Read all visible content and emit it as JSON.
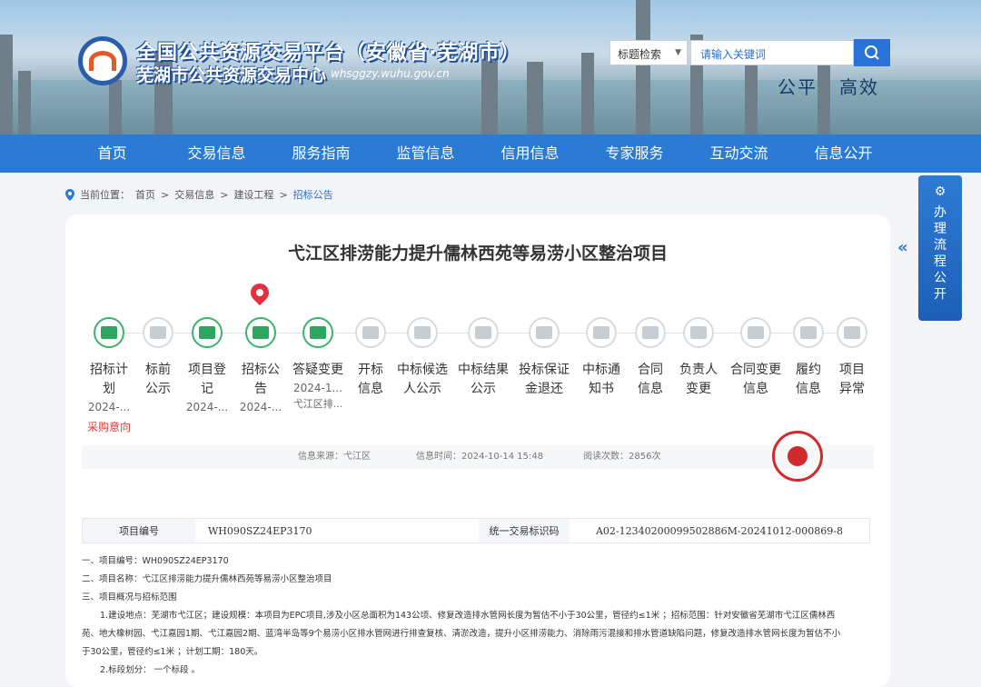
{
  "header": {
    "brand_line1": "全国公共资源交易平台（安徽省·芜湖市）",
    "brand_line2": "芜湖市公共资源交易中心",
    "domain": "whsggzy.wuhu.gov.cn",
    "search_select": "标题检索",
    "search_placeholder": "请输入关键词",
    "motto1": "公平",
    "motto2": "高效",
    "accent": "#2b7ad3"
  },
  "nav": [
    "首页",
    "交易信息",
    "服务指南",
    "监管信息",
    "信用信息",
    "专家服务",
    "互动交流",
    "信息公开"
  ],
  "breadcrumb": {
    "prefix": "当前位置：",
    "items": [
      "首页",
      "交易信息",
      "建设工程"
    ],
    "current": "招标公告",
    "sep": ">"
  },
  "title": "弋江区排涝能力提升儒林西苑等易涝小区整治项目",
  "steps": [
    {
      "l1": "招标计",
      "l2": "划",
      "date": "2024-...",
      "done": true
    },
    {
      "l1": "标前",
      "l2": "公示",
      "date": "",
      "done": false
    },
    {
      "l1": "项目登",
      "l2": "记",
      "date": "2024-...",
      "done": true
    },
    {
      "l1": "招标公",
      "l2": "告",
      "date": "2024-...",
      "done": true
    },
    {
      "l1": "答疑变更",
      "l2": "",
      "date": "2024-1...",
      "date2": "弋江区排...",
      "done": true
    },
    {
      "l1": "开标",
      "l2": "信息",
      "date": "",
      "done": false
    },
    {
      "l1": "中标候选",
      "l2": "人公示",
      "date": "",
      "done": false
    },
    {
      "l1": "中标结果",
      "l2": "公示",
      "date": "",
      "done": false
    },
    {
      "l1": "投标保证",
      "l2": "金退还",
      "date": "",
      "done": false
    },
    {
      "l1": "中标通",
      "l2": "知书",
      "date": "",
      "done": false
    },
    {
      "l1": "合同",
      "l2": "信息",
      "date": "",
      "done": false
    },
    {
      "l1": "负责人",
      "l2": "变更",
      "date": "",
      "done": false
    },
    {
      "l1": "合同变更",
      "l2": "信息",
      "date": "",
      "done": false
    },
    {
      "l1": "履约",
      "l2": "信息",
      "date": "",
      "done": false
    },
    {
      "l1": "项目",
      "l2": "异常",
      "date": "",
      "done": false
    }
  ],
  "purchase_intent": "采购意向",
  "meta": {
    "source": "信息来源：弋江区",
    "time": "信息时间：2024-10-14 15:48",
    "reads": "阅读次数：2856次"
  },
  "table": {
    "h1": "项目编号",
    "v1": "WH090SZ24EP3170",
    "h2": "统一交易标识码",
    "v2": "A02-12340200099502886M-20241012-000869-8"
  },
  "body": [
    "一、项目编号：WH090SZ24EP3170",
    "二、项目名称：弋江区排涝能力提升儒林西苑等易涝小区整治项目",
    "三、项目概况与招标范围",
    "1.建设地点：芜湖市弋江区；建设规模：本项目为EPC项目,涉及小区总面积为143公顷、修复改造排水管网长度为暂估不小于30公里，管径约≤1米 ；招标范围：针对安徽省芜湖市弋江区儒林西",
    "苑、地大橡树园、弋江嘉园1期、弋江嘉园2期、蓝湾半岛等9个易涝小区排水管网进行排查复核、清淤改造，提升小区排涝能力、消除雨污混接和排水管道缺陷问题，修复改造排水管网长度为暂估不小",
    "于30公里，管径约≤1米 ；计划工期：180天。",
    "2.标段划分：  一个标段  。"
  ],
  "side_panel": "办理流程公开"
}
